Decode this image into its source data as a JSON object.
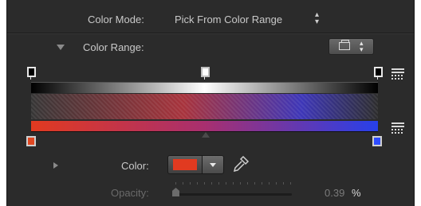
{
  "color_mode": {
    "label": "Color Mode:",
    "value": "Pick From Color Range",
    "stepper_icon": "up-down-arrows-icon"
  },
  "color_range": {
    "label": "Color Range:",
    "expanded": true,
    "preset_button_icon": "gradient-preset-icon",
    "gradient_top": {
      "stops": [
        "#000000",
        "#ffffff",
        "#000000"
      ]
    },
    "gradient_bottom": {
      "start_color": "#e13a20",
      "end_color": "#2740ea"
    },
    "list_icon": "gradient-options-icon"
  },
  "color": {
    "label": "Color:",
    "swatch": "#e13a20",
    "dropper_icon": "eyedropper-icon",
    "expanded": false
  },
  "opacity": {
    "label": "Opacity:",
    "value": "0.39",
    "unit": "%"
  }
}
